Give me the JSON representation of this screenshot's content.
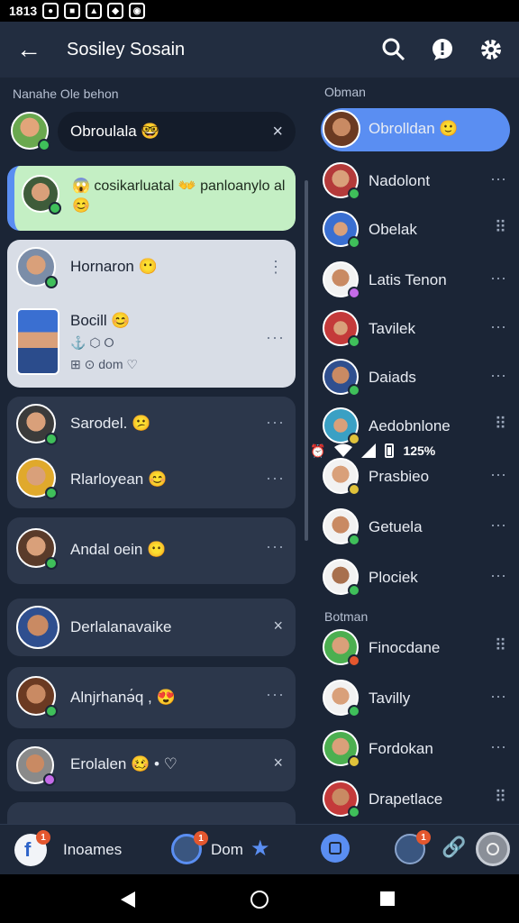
{
  "status": {
    "time": "1813",
    "battery": "125%"
  },
  "appbar": {
    "title": "Sosiley Sosain"
  },
  "left": {
    "section_label": "Nanahe Ole behon",
    "search_value": "Obroulala 🤓",
    "highlight_message": "😱 cosikarluatal 👐 panloanylo al 😊",
    "cards": [
      {
        "name": "Hornaron 😶",
        "more": "⋮"
      },
      {
        "name": "Bocill 😊",
        "sub": "⚓ ⬡ ⭘",
        "sub2": "⊞ ⊙ dom ♡"
      },
      {
        "name": "Sarodel. 😕",
        "more": "···"
      },
      {
        "name": "Rlarloyean 😊",
        "more": "···"
      },
      {
        "name": "Andal oein 😶",
        "more": "···"
      },
      {
        "name": "Derlalanavaike",
        "close": "×"
      },
      {
        "name": "Alnjrhanə́q , 😍",
        "more": "···"
      },
      {
        "name": "Erolalen 🥴 • ♡",
        "close": "×"
      }
    ]
  },
  "right": {
    "section_label": "Obman",
    "section_label2": "Botman",
    "items": [
      {
        "name": "Obrolldan 🙂",
        "more": ""
      },
      {
        "name": "Nadolont",
        "more": "···"
      },
      {
        "name": "Obelak",
        "more": "⠿"
      },
      {
        "name": "Latis Tenon",
        "more": "···"
      },
      {
        "name": "Tavilek",
        "more": "···"
      },
      {
        "name": "Daiads",
        "more": "···"
      },
      {
        "name": "Aedobnlone",
        "more": "⠿"
      },
      {
        "name": "Prasbieo",
        "more": "···"
      },
      {
        "name": "Getuela",
        "more": "···"
      },
      {
        "name": "Plociek",
        "more": "···"
      },
      {
        "name": "Finocdane",
        "more": "⠿"
      },
      {
        "name": "Tavilly",
        "more": "···"
      },
      {
        "name": "Fordokan",
        "more": "···"
      },
      {
        "name": "Drapetlace",
        "more": "⠿"
      }
    ]
  },
  "bottom": {
    "label1": "Inoames",
    "label2": "Dom",
    "badge1": "1",
    "badge2": "1",
    "badge3": "1"
  },
  "colors": {
    "accent": "#5a8ef2",
    "green_bubble": "#c4efc4",
    "card_light": "#d8dde6"
  }
}
